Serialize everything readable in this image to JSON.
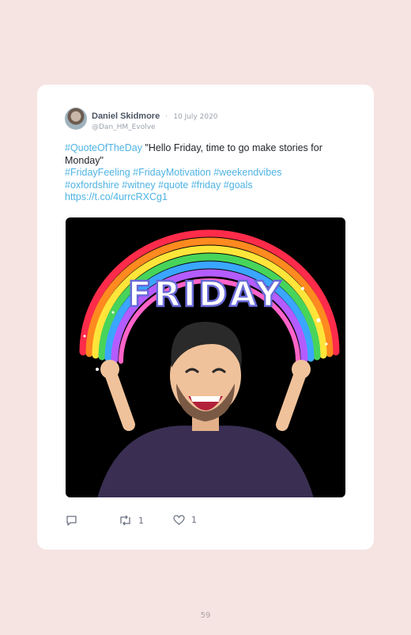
{
  "tweet": {
    "author_name": "Daniel Skidmore",
    "separator": "·",
    "date": "10 July 2020",
    "handle": "@Dan_HM_Evolve",
    "line1_tag": "#QuoteOfTheDay",
    "line1_text": " \"Hello Friday, time to go make stories for Monday\"",
    "hashtags_1": "#FridayFeeling #FridayMotivation #weekendvibes",
    "hashtags_2": "#oxfordshire #witney #quote #friday #goals",
    "short_link": "https://t.co/4urrcRXCg1",
    "image_text": "FRIDAY"
  },
  "actions": {
    "reply_icon": "reply-icon",
    "retweet_icon": "retweet-icon",
    "retweet_count": "1",
    "like_icon": "heart-icon",
    "like_count": "1"
  },
  "page": {
    "number": "59"
  },
  "colors": {
    "link": "#4fb3e3",
    "background": "#f6e4e2"
  }
}
